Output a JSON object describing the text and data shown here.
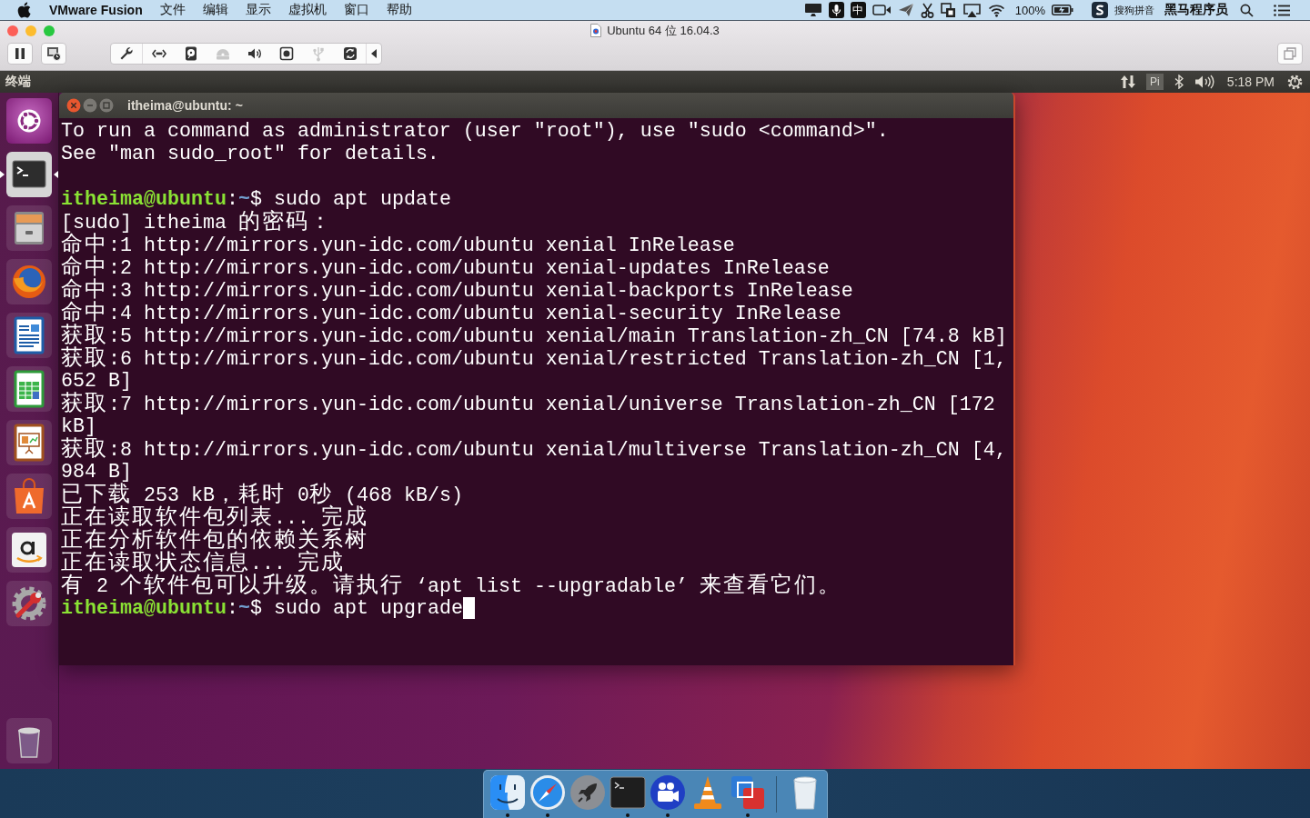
{
  "menu_bar": {
    "app_name": "VMware Fusion",
    "menus": [
      "文件",
      "编辑",
      "显示",
      "虚拟机",
      "窗口",
      "帮助"
    ],
    "input_source": "中",
    "battery": "100%",
    "input_method": "搜狗拼音",
    "user_name": "黑马程序员"
  },
  "vm_window": {
    "title": "Ubuntu 64 位 16.04.3",
    "devices": [
      {
        "kind": "settings",
        "disabled": false
      },
      {
        "kind": "network",
        "disabled": false
      },
      {
        "kind": "disk",
        "disabled": false
      },
      {
        "kind": "optical",
        "disabled": true
      },
      {
        "kind": "sound",
        "disabled": false
      },
      {
        "kind": "camera",
        "disabled": false
      },
      {
        "kind": "usb",
        "disabled": true
      },
      {
        "kind": "sync",
        "disabled": false
      }
    ]
  },
  "ubuntu_panel": {
    "app_title": "终端",
    "input_method": "Pi",
    "clock": "5:18 PM"
  },
  "launcher": [
    {
      "kind": "dash",
      "active": false
    },
    {
      "kind": "terminal",
      "active": true
    },
    {
      "kind": "files",
      "active": false
    },
    {
      "kind": "browser",
      "active": false
    },
    {
      "kind": "writer",
      "active": false
    },
    {
      "kind": "calc",
      "active": false
    },
    {
      "kind": "impress",
      "active": false
    },
    {
      "kind": "software",
      "active": false
    },
    {
      "kind": "shopping",
      "active": false
    },
    {
      "kind": "settings",
      "active": false
    },
    {
      "kind": "trash",
      "active": false
    }
  ],
  "terminal": {
    "title": "itheima@ubuntu: ~",
    "lines": [
      {
        "kind": "output",
        "text": "To run a command as administrator (user \"root\"), use \"sudo <command>\"."
      },
      {
        "kind": "output",
        "text": "See \"man sudo_root\" for details."
      },
      {
        "kind": "blank"
      },
      {
        "kind": "prompt",
        "segments": [
          {
            "kind": "user",
            "text": "itheima@ubuntu"
          },
          {
            "kind": "plain",
            "text": ":"
          },
          {
            "kind": "path",
            "text": "~"
          },
          {
            "kind": "plain",
            "text": "$ sudo apt update"
          }
        ],
        "cursor": false
      },
      {
        "kind": "output",
        "text": "[sudo] itheima 的密码："
      },
      {
        "kind": "output",
        "text": "命中:1 http://mirrors.yun-idc.com/ubuntu xenial InRelease"
      },
      {
        "kind": "output",
        "text": "命中:2 http://mirrors.yun-idc.com/ubuntu xenial-updates InRelease"
      },
      {
        "kind": "output",
        "text": "命中:3 http://mirrors.yun-idc.com/ubuntu xenial-backports InRelease"
      },
      {
        "kind": "output",
        "text": "命中:4 http://mirrors.yun-idc.com/ubuntu xenial-security InRelease"
      },
      {
        "kind": "output",
        "text": "获取:5 http://mirrors.yun-idc.com/ubuntu xenial/main Translation-zh_CN [74.8 kB]"
      },
      {
        "kind": "output",
        "text": "获取:6 http://mirrors.yun-idc.com/ubuntu xenial/restricted Translation-zh_CN [1,"
      },
      {
        "kind": "output",
        "text": "652 B]"
      },
      {
        "kind": "output",
        "text": "获取:7 http://mirrors.yun-idc.com/ubuntu xenial/universe Translation-zh_CN [172"
      },
      {
        "kind": "output",
        "text": "kB]"
      },
      {
        "kind": "output",
        "text": "获取:8 http://mirrors.yun-idc.com/ubuntu xenial/multiverse Translation-zh_CN [4,"
      },
      {
        "kind": "output",
        "text": "984 B]"
      },
      {
        "kind": "output",
        "text": "已下载 253 kB，耗时 0秒 (468 kB/s)"
      },
      {
        "kind": "output",
        "text": "正在读取软件包列表... 完成"
      },
      {
        "kind": "output",
        "text": "正在分析软件包的依赖关系树"
      },
      {
        "kind": "output",
        "text": "正在读取状态信息... 完成"
      },
      {
        "kind": "output",
        "text": "有 2 个软件包可以升级。请执行 ‘apt list --upgradable’ 来查看它们。"
      },
      {
        "kind": "prompt",
        "segments": [
          {
            "kind": "user",
            "text": "itheima@ubuntu"
          },
          {
            "kind": "plain",
            "text": ":"
          },
          {
            "kind": "path",
            "text": "~"
          },
          {
            "kind": "plain",
            "text": "$ sudo apt upgrade"
          }
        ],
        "cursor": true
      }
    ]
  },
  "dock": [
    {
      "kind": "finder",
      "running": true
    },
    {
      "kind": "browser",
      "running": true
    },
    {
      "kind": "launcher",
      "running": false
    },
    {
      "kind": "terminal",
      "running": true
    },
    {
      "kind": "video",
      "running": true
    },
    {
      "kind": "player",
      "running": false
    },
    {
      "kind": "vm",
      "running": true
    },
    {
      "kind": "trash",
      "running": false
    }
  ]
}
